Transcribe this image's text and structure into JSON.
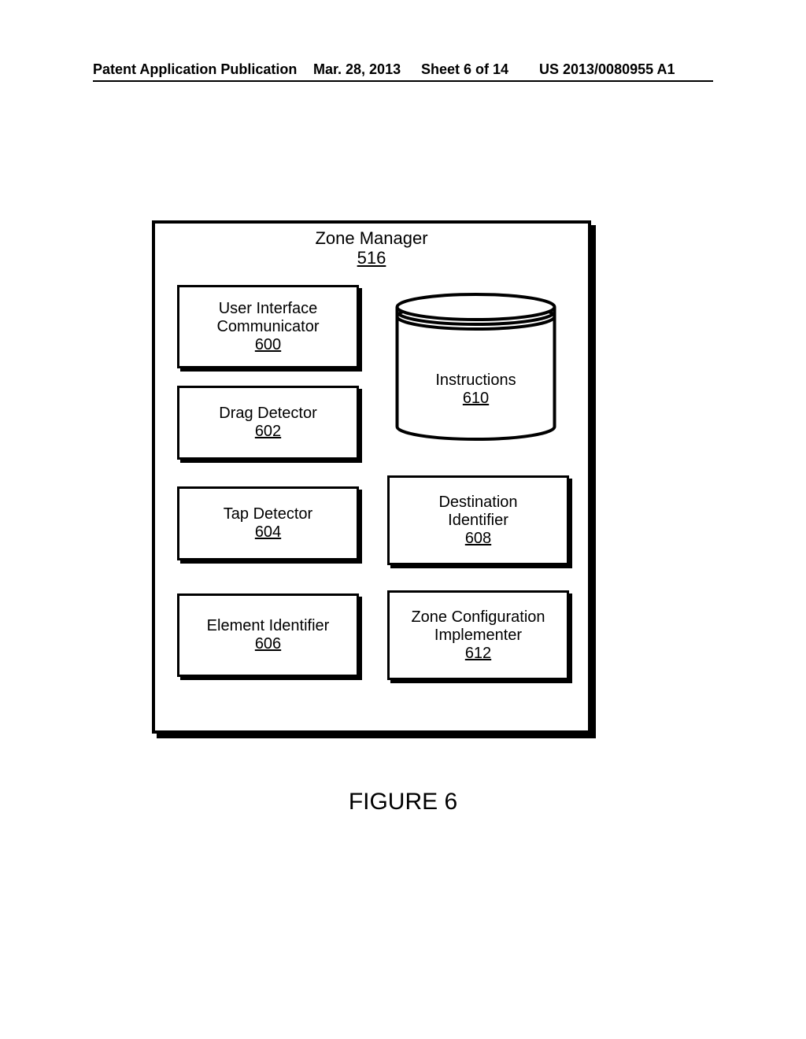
{
  "header": {
    "publication_type": "Patent Application Publication",
    "date": "Mar. 28, 2013",
    "sheet": "Sheet 6 of 14",
    "pub_number": "US 2013/0080955 A1"
  },
  "figure": {
    "caption": "FIGURE 6",
    "container": {
      "label": "Zone Manager",
      "ref": "516"
    },
    "modules": {
      "m600": {
        "label_line1": "User Interface",
        "label_line2": "Communicator",
        "ref": "600"
      },
      "m602": {
        "label": "Drag Detector",
        "ref": "602"
      },
      "m604": {
        "label": "Tap Detector",
        "ref": "604"
      },
      "m606": {
        "label": "Element Identifier",
        "ref": "606"
      },
      "m608": {
        "label_line1": "Destination",
        "label_line2": "Identifier",
        "ref": "608"
      },
      "m610": {
        "label": "Instructions",
        "ref": "610"
      },
      "m612": {
        "label_line1": "Zone Configuration",
        "label_line2": "Implementer",
        "ref": "612"
      }
    }
  }
}
